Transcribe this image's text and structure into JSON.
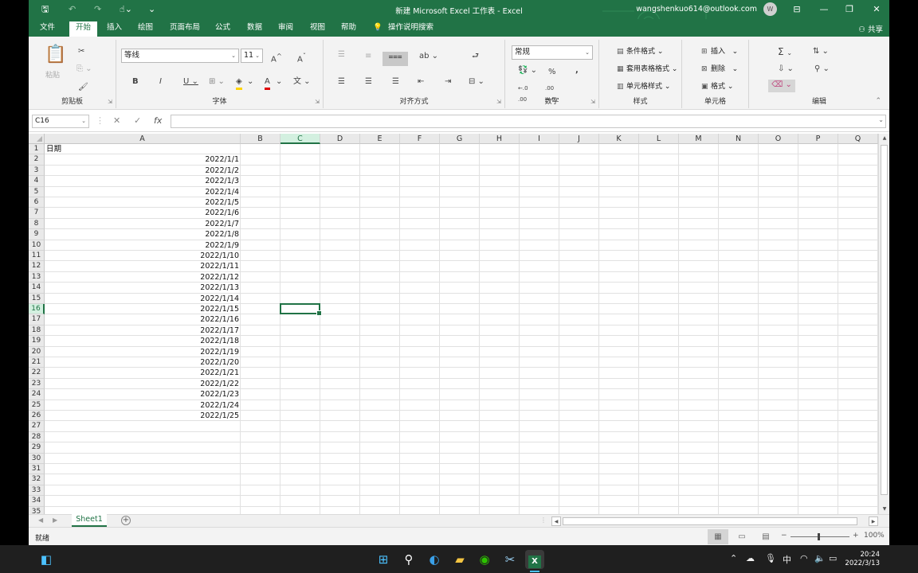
{
  "app": {
    "title": "新建 Microsoft Excel 工作表  -  Excel",
    "email": "wangshenkuo614@outlook.com",
    "avatar_initial": "W",
    "share_label": "共享"
  },
  "menu_tabs": [
    "文件",
    "开始",
    "插入",
    "绘图",
    "页面布局",
    "公式",
    "数据",
    "审阅",
    "视图",
    "帮助"
  ],
  "tell_me": "操作说明搜索",
  "ribbon": {
    "groups": {
      "clipboard": "剪贴板",
      "font": "字体",
      "alignment": "对齐方式",
      "number": "数字",
      "styles": "样式",
      "cells": "单元格",
      "editing": "编辑"
    },
    "paste_label": "粘贴",
    "font_name": "等线",
    "font_size": "11",
    "number_format": "常规",
    "styles_items": [
      "条件格式",
      "套用表格格式",
      "单元格样式"
    ],
    "cells_items": [
      "插入",
      "删除",
      "格式"
    ]
  },
  "formula_bar": {
    "name_box": "C16",
    "fx": "fx",
    "formula": ""
  },
  "grid": {
    "columns": [
      "A",
      "B",
      "C",
      "D",
      "E",
      "F",
      "G",
      "H",
      "I",
      "J",
      "K",
      "L",
      "M",
      "N",
      "O",
      "P",
      "Q"
    ],
    "selected_column": "C",
    "selected_row": 16,
    "row_count": 35,
    "header_cell": "日期",
    "dates": [
      "2022/1/1",
      "2022/1/2",
      "2022/1/3",
      "2022/1/4",
      "2022/1/5",
      "2022/1/6",
      "2022/1/7",
      "2022/1/8",
      "2022/1/9",
      "2022/1/10",
      "2022/1/11",
      "2022/1/12",
      "2022/1/13",
      "2022/1/14",
      "2022/1/15",
      "2022/1/16",
      "2022/1/17",
      "2022/1/18",
      "2022/1/19",
      "2022/1/20",
      "2022/1/21",
      "2022/1/22",
      "2022/1/23",
      "2022/1/24",
      "2022/1/25"
    ]
  },
  "sheets": [
    "Sheet1"
  ],
  "status": {
    "ready": "就绪",
    "zoom": "100%"
  },
  "taskbar": {
    "time": "20:24",
    "date": "2022/3/13",
    "ime": "中"
  },
  "colors": {
    "brand": "#217346",
    "taskbar": "#1f1f1f"
  }
}
